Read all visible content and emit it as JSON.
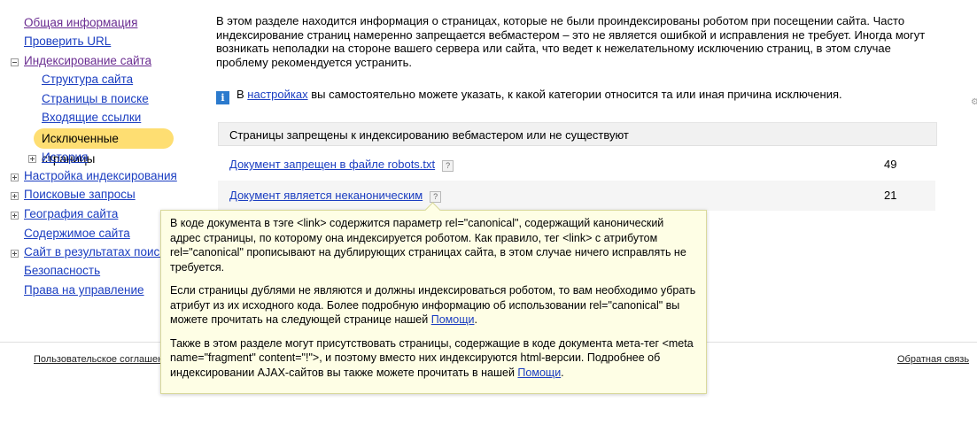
{
  "sidebar": {
    "items": [
      {
        "label": "Общая информация"
      },
      {
        "label": "Проверить URL"
      },
      {
        "label": "Индексирование сайта"
      },
      {
        "label": "Структура сайта"
      },
      {
        "label": "Страницы в поиске"
      },
      {
        "label": "Входящие ссылки"
      },
      {
        "label": "Исключенные страницы"
      },
      {
        "label": "История"
      },
      {
        "label": "Настройка индексирования"
      },
      {
        "label": "Поисковые запросы"
      },
      {
        "label": "География сайта"
      },
      {
        "label": "Содержимое сайта"
      },
      {
        "label": "Сайт в результатах поиска"
      },
      {
        "label": "Безопасность"
      },
      {
        "label": "Права на управление"
      }
    ]
  },
  "main": {
    "intro": "В этом разделе находится информация о страницах, которые не были проиндексированы роботом при посещении сайта. Часто индексирование страниц намеренно запрещается вебмастером – это не является ошибкой и исправления не требует. Иногда могут возникать неполадки на стороне вашего сервера или сайта, что ведет к нежелательному исключению страниц, в этом случае проблему рекомендуется устранить.",
    "info_icon": "i",
    "info_prefix": "В",
    "info_link": "настройках",
    "info_suffix": "вы самостоятельно можете указать, к какой категории относится та или иная причина исключения.",
    "table_header": "Страницы запрещены к индексированию вебмастером или не существуют",
    "rows": [
      {
        "reason": "Документ запрещен в файле robots.txt",
        "count": "49"
      },
      {
        "reason": "Документ является неканоническим",
        "count": "21"
      }
    ],
    "help_glyph": "?"
  },
  "tooltip": {
    "p1": "В коде документа в тэге <link> содержится параметр rel=\"canonical\", содержащий канонический адрес страницы, по которому она индексируется роботом. Как правило, тег <link> с атрибутом rel=\"canonical\" прописывают на дублирующих страницах сайта, в этом случае ничего исправлять не требуется.",
    "p2_text": "Если страницы дублями не являются и должны индексироваться роботом, то вам необходимо убрать атрибут из их исходного кода. Более подробную информацию об использовании rel=\"canonical\" вы можете прочитать на следующей странице нашей",
    "p2_link": "Помощи",
    "p3_text": "Также в этом разделе могут присутствовать страницы, содержащие в коде документа мета-тег <meta name=\"fragment\" content=\"!\">, и поэтому вместо них индексируются html-версии. Подробнее об индексировании AJAX-сайтов вы также можете прочитать в нашей",
    "p3_link": "Помощи",
    "period": "."
  },
  "footer": {
    "left_link": "Пользовательское соглашение",
    "right_link": "Обратная связь"
  },
  "colors": {
    "link": "#1a3dc1",
    "visited": "#6a2c91",
    "active_bg": "#fede72",
    "tooltip_bg": "#fefee5",
    "info_icon": "#2b7acd"
  }
}
